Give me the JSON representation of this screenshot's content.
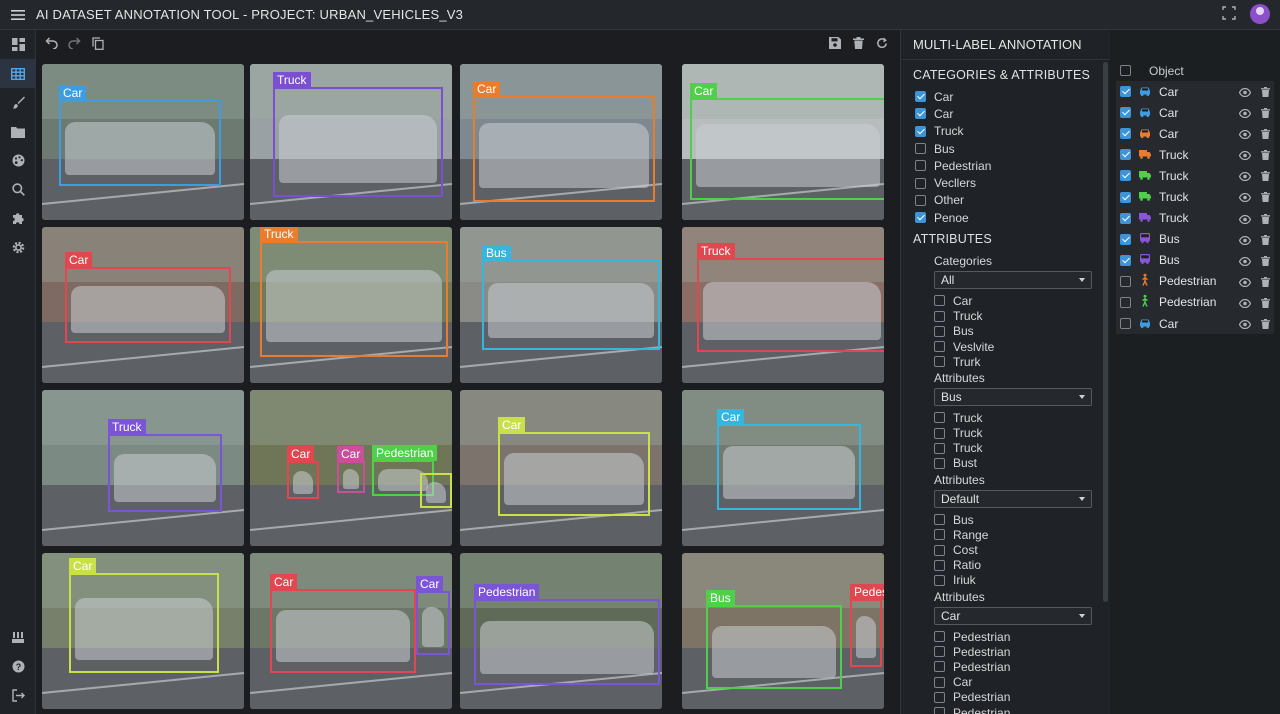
{
  "app": {
    "title": "AI DATASET ANNOTATION TOOL - PROJECT: URBAN_VEHICLES_V3"
  },
  "colors": {
    "blue": "#3d9ddf",
    "purple": "#7b4fd1",
    "orange": "#ea7c2e",
    "green": "#4fcf4a",
    "red": "#e0474f",
    "pink": "#c8509a",
    "lime": "#c9e048",
    "cyan": "#35b6e0",
    "violet": "#7a55d6"
  },
  "tiles": [
    {
      "bg": "#6c7a72",
      "boxes": [
        {
          "label": "Car",
          "color": "#3d9ddf"
        }
      ]
    },
    {
      "bg": "#9aa1a4",
      "boxes": [
        {
          "label": "Truck",
          "color": "#7b4fd1"
        }
      ]
    },
    {
      "bg": "#7e8890",
      "boxes": [
        {
          "label": "Car",
          "color": "#ea7c2e"
        }
      ]
    },
    {
      "bg": "#b9bcbe",
      "boxes": [
        {
          "label": "Car",
          "color": "#4fcf4a"
        }
      ]
    },
    {
      "bg": "#7d6a62",
      "boxes": [
        {
          "label": "Car",
          "color": "#e0474f"
        }
      ]
    },
    {
      "bg": "#6f7a5c",
      "boxes": [
        {
          "label": "Truck",
          "color": "#ea7c2e"
        }
      ]
    },
    {
      "bg": "#8a8a86",
      "boxes": [
        {
          "label": "Bus",
          "color": "#35b6e0"
        }
      ]
    },
    {
      "bg": "#8a6e66",
      "boxes": [
        {
          "label": "Truck",
          "color": "#e0474f"
        }
      ]
    },
    {
      "bg": "#7c8a84",
      "boxes": [
        {
          "label": "Truck",
          "color": "#7a55d6"
        }
      ]
    },
    {
      "bg": "#6f7658",
      "boxes": [
        {
          "label": "Car",
          "color": "#e0474f"
        },
        {
          "label": "Car",
          "color": "#c8509a"
        },
        {
          "label": "Pedestrian",
          "color": "#4fcf4a"
        },
        {
          "label": "",
          "color": "#c9e048"
        }
      ]
    },
    {
      "bg": "#7b736c",
      "boxes": [
        {
          "label": "Car",
          "color": "#c9e048"
        }
      ]
    },
    {
      "bg": "#727a70",
      "boxes": [
        {
          "label": "Car",
          "color": "#35b6e0"
        }
      ]
    },
    {
      "bg": "#77806a",
      "boxes": [
        {
          "label": "Car",
          "color": "#c9e048"
        }
      ]
    },
    {
      "bg": "#6d7768",
      "boxes": [
        {
          "label": "Car",
          "color": "#e0474f"
        },
        {
          "label": "Car",
          "color": "#7a55d6"
        }
      ]
    },
    {
      "bg": "#5f6a58",
      "boxes": [
        {
          "label": "Pedestrian",
          "color": "#7a55d6"
        }
      ]
    },
    {
      "bg": "#7e7466",
      "boxes": [
        {
          "label": "Bus",
          "color": "#4fcf4a"
        },
        {
          "label": "Pedestrian",
          "color": "#e0474f"
        }
      ]
    }
  ],
  "panel": {
    "title": "MULTI-LABEL ANNOTATION",
    "categories_title": "CATEGORIES & ATTRIBUTES",
    "categories": [
      {
        "label": "Car",
        "checked": true
      },
      {
        "label": "Car",
        "checked": true
      },
      {
        "label": "Truck",
        "checked": true
      },
      {
        "label": "Bus",
        "checked": false
      },
      {
        "label": "Pedestrian",
        "checked": false
      },
      {
        "label": "Vecllers",
        "checked": false
      },
      {
        "label": "Other",
        "checked": false
      },
      {
        "label": "Penoe",
        "checked": true
      }
    ],
    "attributes_title": "ATTRIBUTES",
    "groups": [
      {
        "label": "Categories",
        "select": "All",
        "options": [
          "Car",
          "Truck",
          "Bus",
          "Veslvite",
          "Trurk"
        ]
      },
      {
        "label": "Attributes",
        "select": "Bus",
        "options": [
          "Truck",
          "Truck",
          "Truck",
          "Bust"
        ]
      },
      {
        "label": "Attributes",
        "select": "Default",
        "options": [
          "Bus",
          "Range",
          "Cost",
          "Ratio",
          "Iriuk"
        ]
      },
      {
        "label": "Attributes",
        "select": "Car",
        "options": [
          "Pedestrian",
          "Pedestrian",
          "Pedestrian",
          "Car",
          "Pedestrian",
          "Pedestrian"
        ]
      }
    ]
  },
  "objects": {
    "header": "Object",
    "items": [
      {
        "label": "Car",
        "color": "#3d9ddf",
        "icon": "car-icon",
        "checked": true
      },
      {
        "label": "Car",
        "color": "#3d9ddf",
        "icon": "car-icon",
        "checked": true
      },
      {
        "label": "Car",
        "color": "#ea7c2e",
        "icon": "car-icon",
        "checked": true
      },
      {
        "label": "Truck",
        "color": "#ea7c2e",
        "icon": "truck-icon",
        "checked": true
      },
      {
        "label": "Truck",
        "color": "#4fcf4a",
        "icon": "truck-icon",
        "checked": true
      },
      {
        "label": "Truck",
        "color": "#4fcf4a",
        "icon": "truck-icon",
        "checked": true
      },
      {
        "label": "Truck",
        "color": "#8a55d6",
        "icon": "truck-icon",
        "checked": true
      },
      {
        "label": "Bus",
        "color": "#8a55d6",
        "icon": "bus-icon",
        "checked": true
      },
      {
        "label": "Bus",
        "color": "#8a55d6",
        "icon": "bus-icon",
        "checked": true
      },
      {
        "label": "Pedestrian",
        "color": "#ea7c2e",
        "icon": "pedestrian-icon",
        "checked": false
      },
      {
        "label": "Pedestrian",
        "color": "#4fcf4a",
        "icon": "pedestrian-icon",
        "checked": false
      },
      {
        "label": "Car",
        "color": "#3d9ddf",
        "icon": "car-icon",
        "checked": false
      }
    ]
  }
}
